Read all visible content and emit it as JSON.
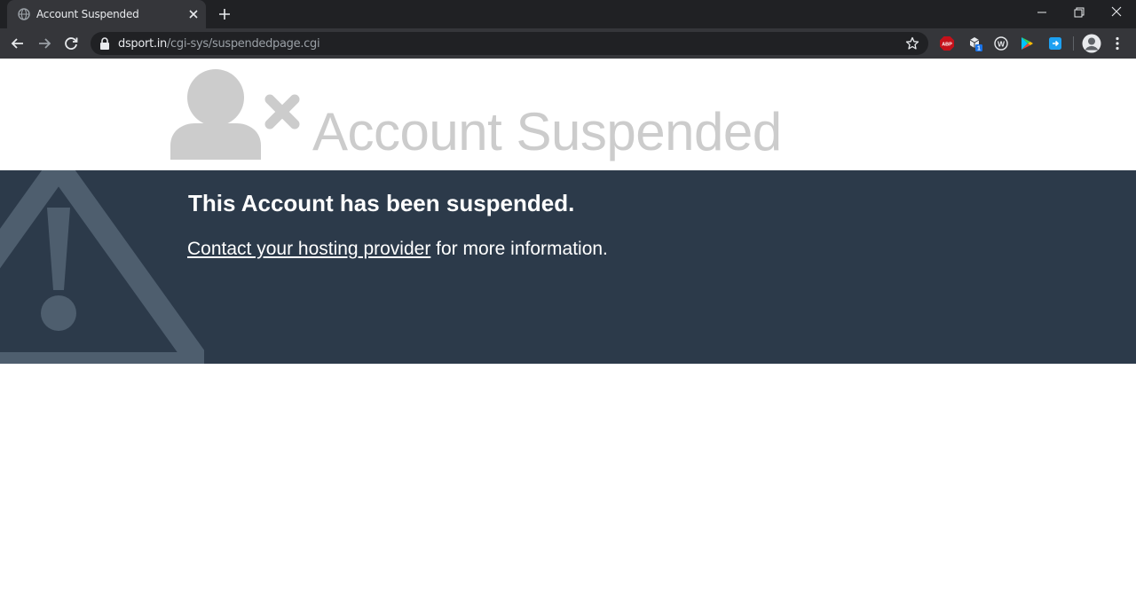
{
  "browser": {
    "tab": {
      "title": "Account Suspended",
      "favicon": "globe-icon"
    },
    "new_tab_icon": "plus-icon",
    "window_controls": [
      "minimize-icon",
      "restore-icon",
      "close-icon"
    ],
    "nav_icons": [
      "back-arrow-icon",
      "forward-arrow-icon",
      "reload-icon"
    ],
    "address_bar": {
      "host": "dsport.in",
      "path": "/cgi-sys/suspendedpage.cgi",
      "lock_icon": "lock-icon",
      "bookmark_icon": "star-icon"
    },
    "extensions": [
      {
        "name": "adblock-plus-icon",
        "label": "ABP"
      },
      {
        "name": "extension-box-icon",
        "badge": "1"
      },
      {
        "name": "w-extension-icon",
        "label": "W"
      },
      {
        "name": "play-extension-icon"
      },
      {
        "name": "save-extension-icon"
      }
    ],
    "profile_icon": "avatar-icon",
    "menu_icon": "kebab-menu-icon"
  },
  "page": {
    "title": "Account Suspended",
    "heading": "This Account has been suspended.",
    "link_text": "Contact your hosting provider",
    "text_after_link": " for more information."
  },
  "colors": {
    "banner_bg": "#2c3a4a",
    "title_gray": "#cccccc",
    "warning_icon": "#4e5e6e"
  }
}
